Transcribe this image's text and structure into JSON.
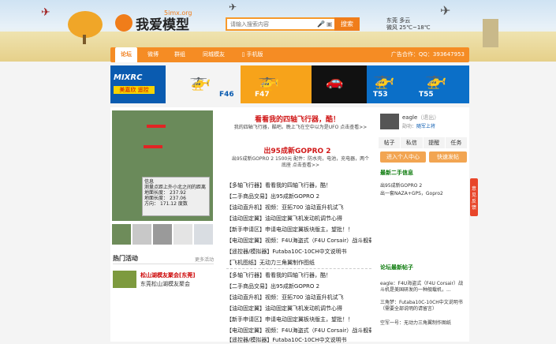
{
  "header": {
    "logo_text": "我爱模型",
    "logo_sub": "5imx.org",
    "search_placeholder": "请输入搜索内容",
    "search_button": "搜索",
    "weather_city": "东莞 多云",
    "weather_temp": "微风 25℃~18℃"
  },
  "nav": {
    "items": [
      "论坛",
      "微博",
      "群组",
      "同城模友",
      "手机版"
    ],
    "ad_contact": "广告合作：QQ：393647953"
  },
  "banner": {
    "brand": "MIXRC",
    "tag": "美嘉欣 遥控",
    "models": [
      "F46",
      "F47",
      "T53",
      "T55"
    ]
  },
  "left": {
    "hot_title": "热门活动",
    "more": "更多活动",
    "event_title": "松山湖模友聚会[东莞]",
    "event_sub": "东莞松山湖模友聚会"
  },
  "center": {
    "headline1": "看看我的四轴飞行器，酷！",
    "desc1": "我的四轴飞行器，酷吧。晚上飞在空中以为是UFO 点击查看>>",
    "headline2": "出95成新GOPRO 2",
    "desc2": "出95成新GOPRO 2 1500元 配件：防水壳，电池，充电器，两个底座 点击查看>>",
    "list1": [
      "【多轴飞行器】看看我的四轴飞行器，酷！",
      "【二手商品交易】出95成新GOPRO 2",
      "【油动直升机】视频：亚拓700 油动直升机试飞",
      "【油动固定翼】油动固定翼飞机发动机调节心得",
      "【新手申请区】申请电动固定翼板块版主，望批！！",
      "【电动固定翼】视频：F4U海盗式（F4U Corsair）战斗舰载",
      "【遥控器/模拟器】Futaba10C-10CH中文说明书",
      "【飞机图纸】无动力三角翼制作图纸"
    ],
    "list2": [
      "【多轴飞行器】看看我的四轴飞行器，酷！",
      "【二手商品交易】出95成新GOPRO 2",
      "【油动直升机】视频：亚拓700 油动直升机试飞",
      "【油动固定翼】油动固定翼飞机发动机调节心得",
      "【新手申请区】申请电动固定翼板块版主，望批！！",
      "【电动固定翼】视频：F4U海盗式（F4U Corsair）战斗舰载",
      "【遥控器/模拟器】Futaba10C-10CH中文说明书"
    ]
  },
  "right": {
    "username": "eagle",
    "username_note": "（退出）",
    "user_link_prefix": "勋功：",
    "user_link": "随军上将",
    "tabs": [
      "帖子",
      "私信",
      "提醒",
      "任务"
    ],
    "btn_personal": "进入个人中心",
    "btn_post": "快速发帖",
    "second_title": "最新二手信息",
    "second_items": [
      "出95成新GOPRO 2",
      "出一套NAZA+GPS，Gopro2"
    ],
    "forum_title": "论坛最新帖子",
    "forum_items": [
      "eagle：F4U海盗式（F4U Corsair）战斗机是美国研发的一种舰载机，...",
      "三角梦：Futaba10C-10CH中文说明书（需要全部说明的请留言）",
      "空军一号：无动力三角翼制作图纸"
    ]
  },
  "float_button": "意见反馈",
  "photo_overlay": {
    "lines": [
      "信息",
      "测量点距上外小北之间的距离",
      "地面长度：",
      "237.92",
      "地面长度：",
      "237.06",
      "方向：",
      "171.12 度数"
    ]
  }
}
